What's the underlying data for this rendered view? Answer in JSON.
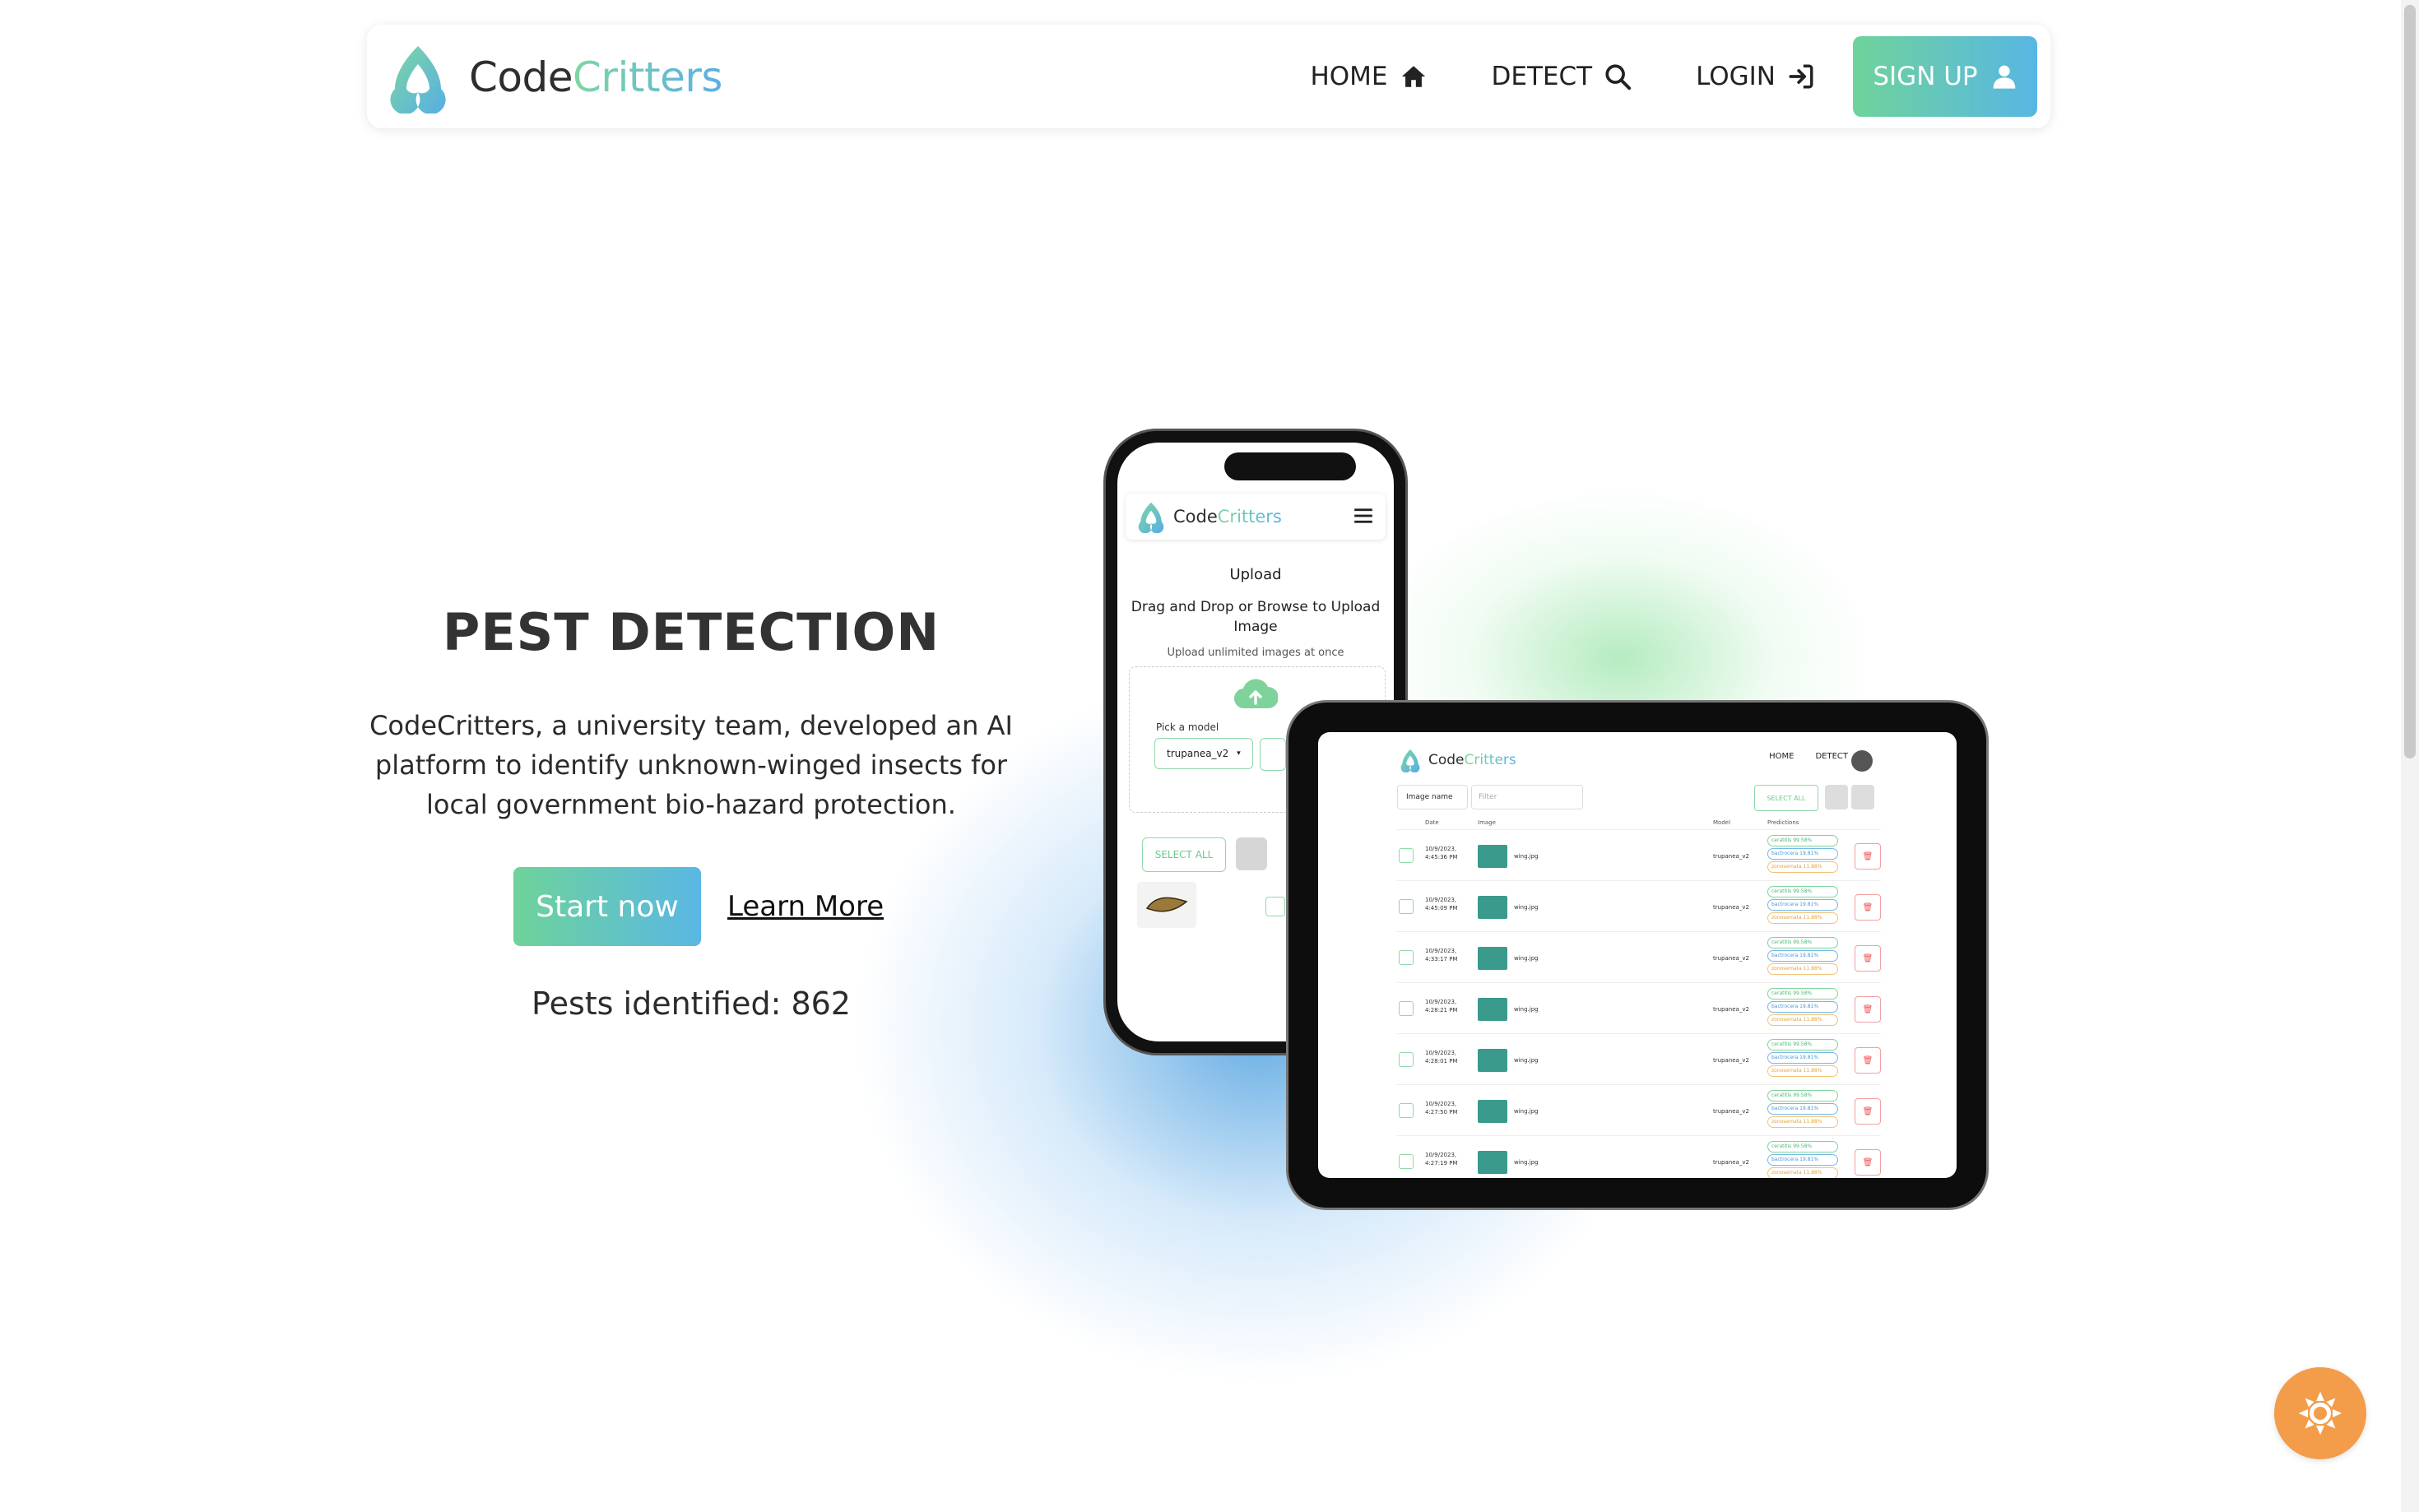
{
  "brand": {
    "code": "Code",
    "critters": "Critters"
  },
  "nav": {
    "home": "HOME",
    "detect": "DETECT",
    "login": "LOGIN",
    "signup": "SIGN UP"
  },
  "hero": {
    "title": "PEST DETECTION",
    "description": "CodeCritters, a university team, developed an AI platform to identify unknown-winged insects for local government bio-hazard protection.",
    "start_label": "Start now",
    "learn_label": "Learn More",
    "pests_identified": "Pests identified: 862"
  },
  "phone": {
    "brand_code": "Code",
    "brand_critters": "Critters",
    "upload_title": "Upload",
    "upload_subtitle": "Drag and Drop or Browse to Upload Image",
    "upload_note": "Upload unlimited images at once",
    "pick_model_label": "Pick a model",
    "model_value": "trupanea_v2",
    "select_all": "SELECT ALL"
  },
  "tablet": {
    "brand_code": "Code",
    "brand_critters": "Critters",
    "nav_home": "HOME",
    "nav_detect": "DETECT",
    "sort_label": "Image name",
    "filter_placeholder": "Filter",
    "select_all": "SELECT ALL",
    "columns": [
      "Date",
      "Image",
      "Model",
      "Predictions"
    ],
    "rows": [
      {
        "date": "10/9/2023, 4:45:36 PM",
        "file": "wing.jpg",
        "model": "trupanea_v2",
        "preds": [
          "ceratitis 99.58%",
          "bactrocera 19.81%",
          "zonosemata 11.88%"
        ]
      },
      {
        "date": "10/9/2023, 4:45:09 PM",
        "file": "wing.jpg",
        "model": "trupanea_v2",
        "preds": [
          "ceratitis 99.58%",
          "bactrocera 19.81%",
          "zonosemata 11.88%"
        ]
      },
      {
        "date": "10/9/2023, 4:33:17 PM",
        "file": "wing.jpg",
        "model": "trupanea_v2",
        "preds": [
          "ceratitis 99.58%",
          "bactrocera 19.81%",
          "zonosemata 11.88%"
        ]
      },
      {
        "date": "10/9/2023, 4:28:21 PM",
        "file": "wing.jpg",
        "model": "trupanea_v2",
        "preds": [
          "ceratitis 99.58%",
          "bactrocera 19.81%",
          "zonosemata 11.88%"
        ]
      },
      {
        "date": "10/9/2023, 4:28:01 PM",
        "file": "wing.jpg",
        "model": "trupanea_v2",
        "preds": [
          "ceratitis 99.58%",
          "bactrocera 19.81%",
          "zonosemata 11.88%"
        ]
      },
      {
        "date": "10/9/2023, 4:27:50 PM",
        "file": "wing.jpg",
        "model": "trupanea_v2",
        "preds": [
          "ceratitis 99.58%",
          "bactrocera 19.81%",
          "zonosemata 11.88%"
        ]
      },
      {
        "date": "10/9/2023, 4:27:19 PM",
        "file": "wing.jpg",
        "model": "trupanea_v2",
        "preds": [
          "ceratitis 99.58%",
          "bactrocera 19.81%",
          "zonosemata 11.88%"
        ]
      }
    ]
  },
  "colors": {
    "gradient_start": "#6fd39b",
    "gradient_end": "#58b6e4",
    "theme_button": "#f39c4a"
  },
  "icons": [
    "logo-icon",
    "home-icon",
    "search-icon",
    "login-icon",
    "user-icon",
    "menu-icon",
    "cloud-upload-icon",
    "sun-icon"
  ]
}
